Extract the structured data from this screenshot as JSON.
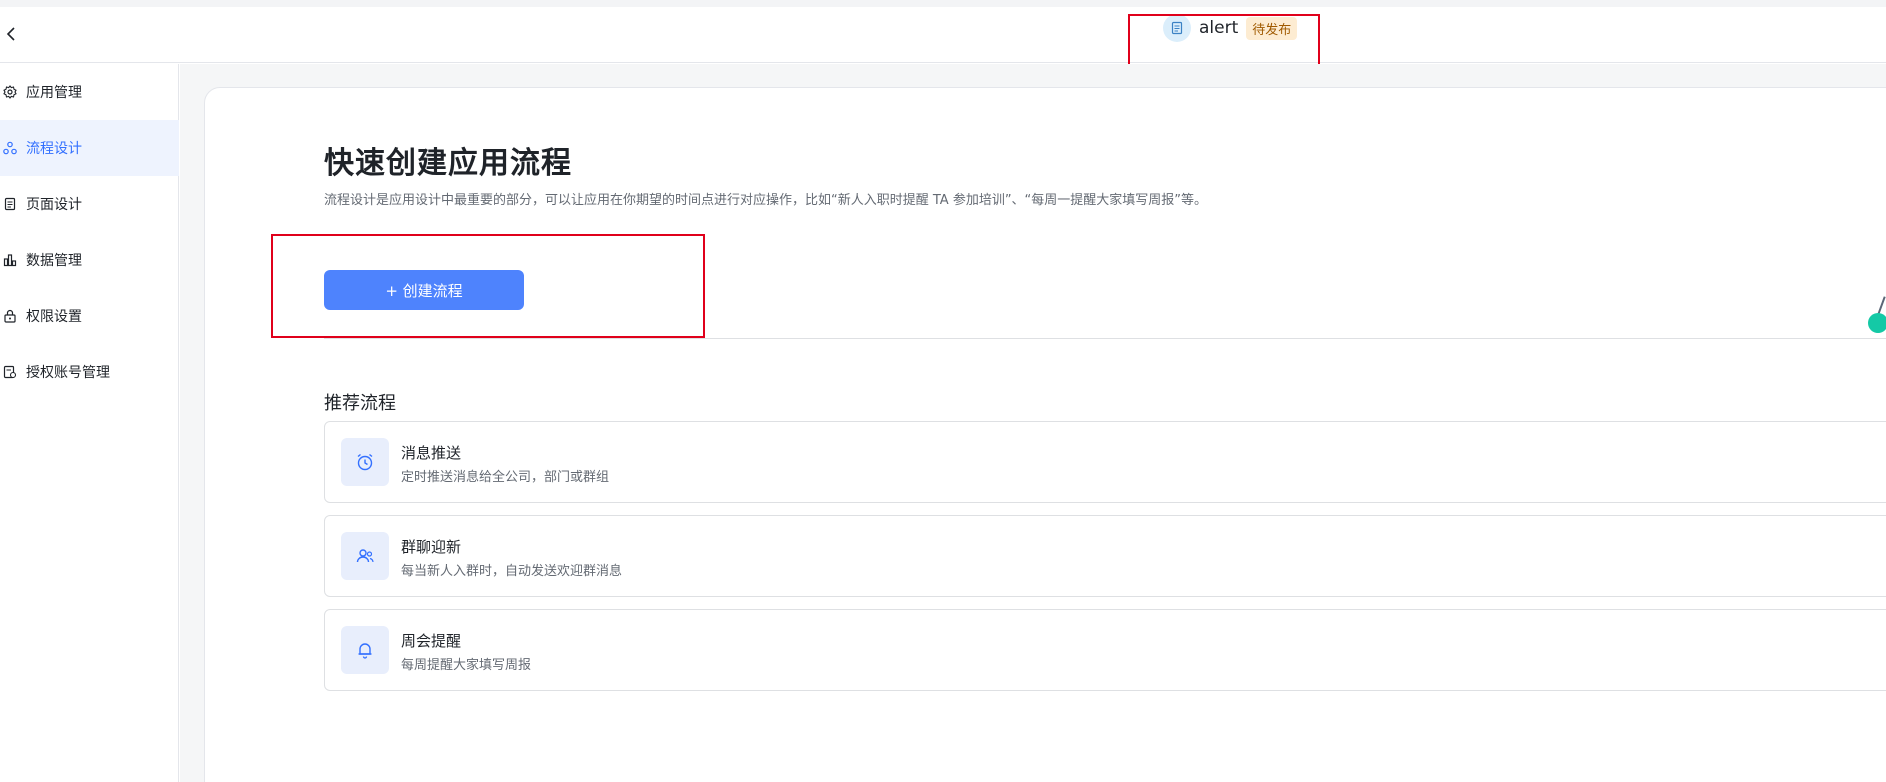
{
  "header": {
    "app_name": "alert",
    "status": "待发布"
  },
  "sidebar": {
    "items": [
      {
        "label": "应用管理",
        "icon": "gear-icon"
      },
      {
        "label": "流程设计",
        "icon": "flow-icon",
        "active": true
      },
      {
        "label": "页面设计",
        "icon": "page-icon"
      },
      {
        "label": "数据管理",
        "icon": "bar-chart-icon"
      },
      {
        "label": "权限设置",
        "icon": "lock-icon"
      },
      {
        "label": "授权账号管理",
        "icon": "account-icon"
      }
    ]
  },
  "main": {
    "title": "快速创建应用流程",
    "description": "流程设计是应用设计中最重要的部分，可以让应用在你期望的时间点进行对应操作，比如“新人入职时提醒 TA 参加培训”、“每周一提醒大家填写周报”等。",
    "create_button": "+ 创建流程",
    "recommend_title": "推荐流程",
    "recommendations": [
      {
        "name": "消息推送",
        "desc": "定时推送消息给全公司，部门或群组",
        "icon": "alarm-clock-icon"
      },
      {
        "name": "群聊迎新",
        "desc": "每当新人入群时，自动发送欢迎群消息",
        "icon": "users-icon"
      },
      {
        "name": "周会提醒",
        "desc": "每周提醒大家填写周报",
        "icon": "bell-icon"
      }
    ]
  },
  "colors": {
    "accent": "#3370ff",
    "button": "#4e83fd",
    "annotation": "#e0001b",
    "badge_bg": "#fdecd2"
  }
}
